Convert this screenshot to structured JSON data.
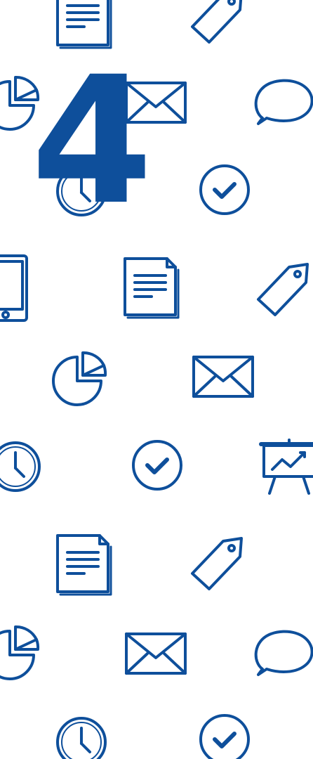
{
  "hero": {
    "number": "4"
  },
  "colors": {
    "icon_stroke": "#0e4f9b",
    "background": "#ffffff"
  },
  "icons": [
    "document-icon",
    "tag-icon",
    "pie-chart-icon",
    "envelope-icon",
    "chat-bubble-icon",
    "clock-icon",
    "check-circle-icon",
    "tablet-icon",
    "presentation-chart-icon"
  ]
}
